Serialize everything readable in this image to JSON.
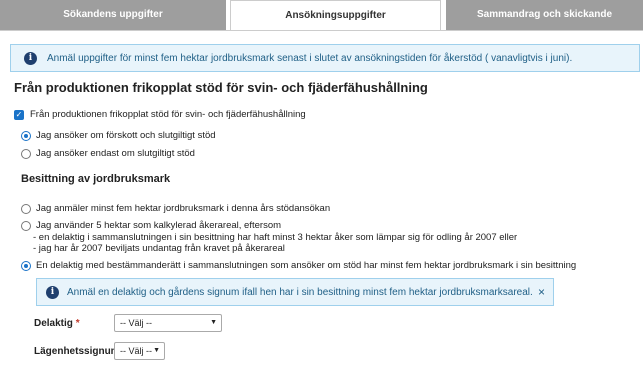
{
  "tabs": [
    {
      "label": "Sökandens uppgifter"
    },
    {
      "label": "Ansökningsuppgifter"
    },
    {
      "label": "Sammandrag och skickande"
    }
  ],
  "info_banner": {
    "text": "Anmäl uppgifter för minst fem hektar jordbruksmark senast i slutet av ansökningstiden för åkerstöd ( vanavligtvis i juni)."
  },
  "section_title": "Från produktionen frikopplat stöd för svin- och fjäderfähushållning",
  "checkbox": {
    "label": "Från produktionen frikopplat stöd för svin- och fjäderfähushållning",
    "checked": true
  },
  "aid_options": [
    {
      "label": "Jag ansöker om förskott och slutgiltigt stöd",
      "selected": true
    },
    {
      "label": "Jag ansöker endast om slutgiltigt stöd",
      "selected": false
    }
  ],
  "possession": {
    "title": "Besittning av jordbruksmark",
    "options": [
      {
        "label": "Jag anmäler minst fem hektar jordbruksmark i denna års stödansökan",
        "selected": false
      },
      {
        "label": "Jag använder 5 hektar som kalkylerad åkerareal, eftersom",
        "selected": false,
        "sub_lines": [
          "- en delaktig i sammanslutningen i sin besittning har haft minst 3 hektar åker som lämpar sig för odling år 2007 eller",
          "- jag har år 2007 beviljats undantag från kravet på åkerareal"
        ]
      },
      {
        "label": "En delaktig med bestämmanderätt i sammanslutningen som ansöker om stöd har minst fem hektar jordbruksmark i sin besittning",
        "selected": true
      }
    ]
  },
  "member_banner": {
    "text": "Anmäl en delaktig och gårdens signum ifall hen har i sin besittning minst fem hektar jordbruksmarksareal.",
    "close": "×"
  },
  "fields": {
    "delaktig": {
      "label": "Delaktig",
      "required_mark": "*",
      "value": "-- Välj --"
    },
    "signum": {
      "label": "Lägenhetssignum",
      "value": "-- Välj --"
    }
  }
}
